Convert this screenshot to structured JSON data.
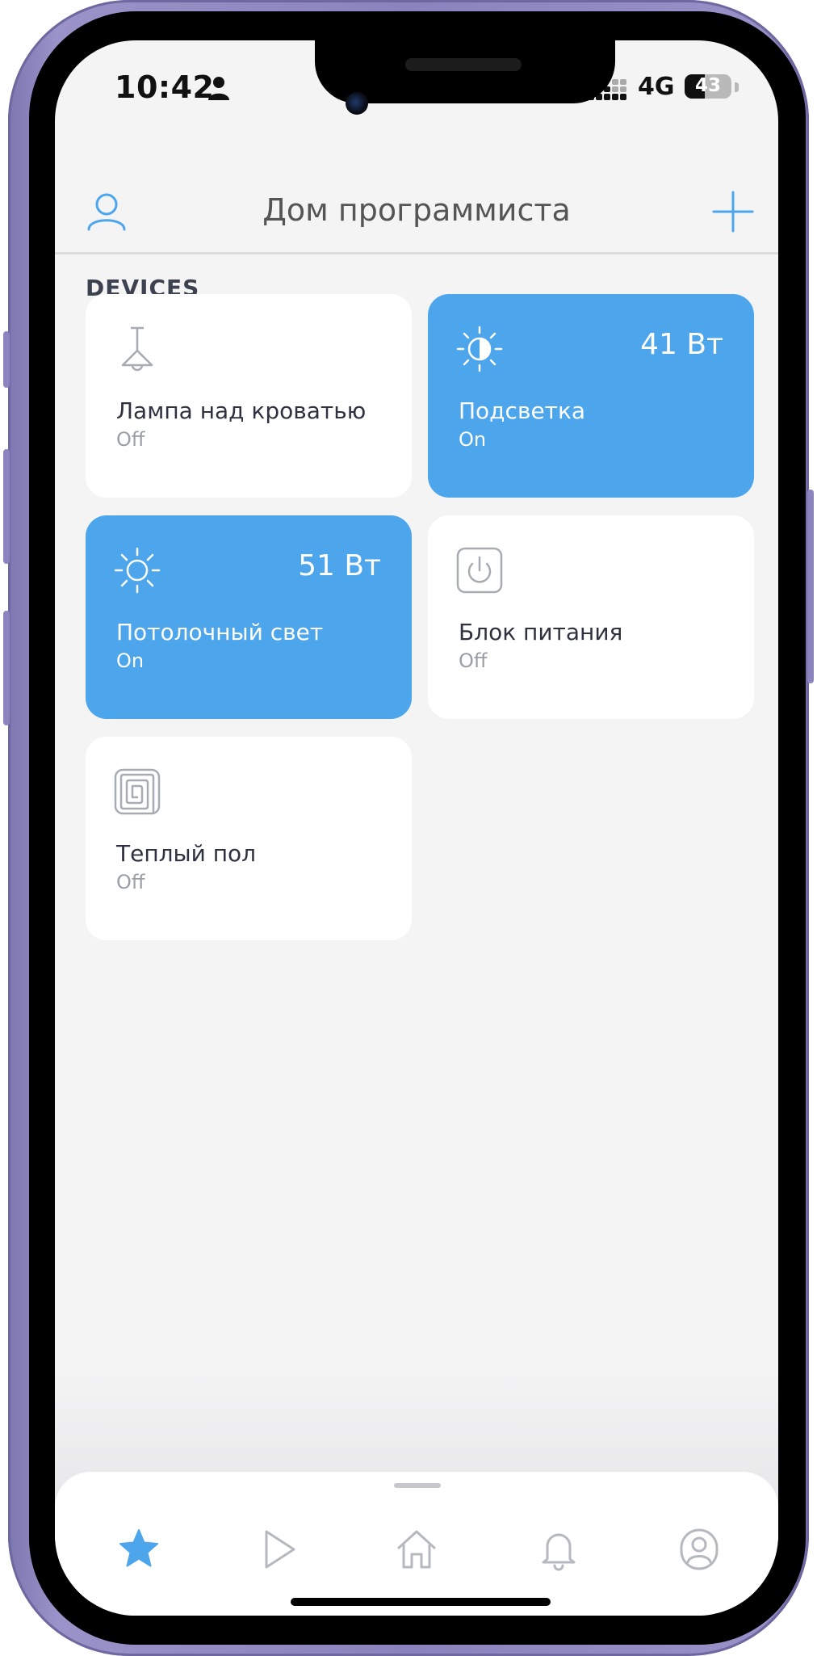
{
  "status_bar": {
    "time": "10:42",
    "network": "4G",
    "battery": "43",
    "battery_level_percent": 43
  },
  "header": {
    "title": "Дом программиста",
    "profile_icon": "user-icon",
    "add_icon": "plus-icon"
  },
  "section": {
    "label": "DEVICES"
  },
  "devices": [
    {
      "name": "Лампа над кроватью",
      "state": "Off",
      "power": "",
      "icon": "pendant-lamp-icon",
      "on": false
    },
    {
      "name": "Подсветка",
      "state": "On",
      "power": "41 Вт",
      "icon": "dimmer-sun-icon",
      "on": true
    },
    {
      "name": "Потолочный свет",
      "state": "On",
      "power": "51 Вт",
      "icon": "sun-icon",
      "on": true
    },
    {
      "name": "Блок питания",
      "state": "Off",
      "power": "",
      "icon": "power-socket-icon",
      "on": false
    },
    {
      "name": "Теплый пол",
      "state": "Off",
      "power": "",
      "icon": "heated-floor-icon",
      "on": false
    }
  ],
  "bottom_nav": [
    {
      "icon": "star-icon",
      "active": true
    },
    {
      "icon": "play-icon",
      "active": false
    },
    {
      "icon": "home-icon",
      "active": false
    },
    {
      "icon": "bell-icon",
      "active": false
    },
    {
      "icon": "profile-icon",
      "active": false
    }
  ],
  "colors": {
    "accent": "#4da6ec",
    "background": "#f4f4f5",
    "card": "#ffffff",
    "text_primary": "#2d3140",
    "text_secondary": "#9a9ea6",
    "frame": "#8a83bd"
  }
}
